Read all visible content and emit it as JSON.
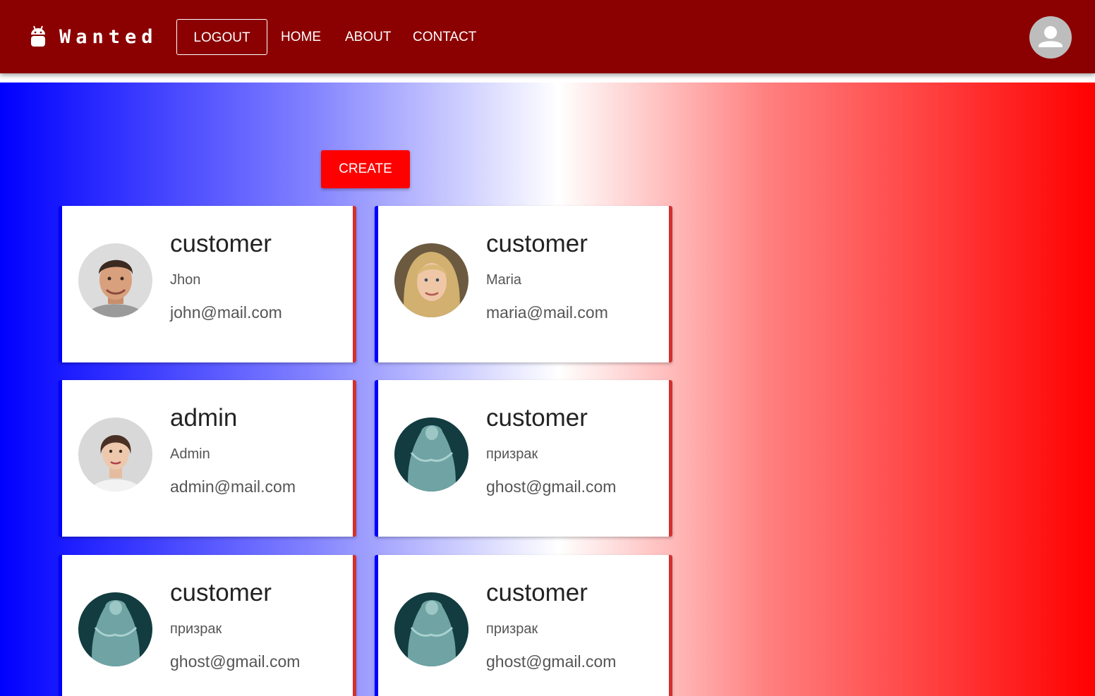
{
  "header": {
    "brand": "Wanted",
    "brand_icon": "android-icon",
    "logout_label": "LOGOUT",
    "nav": [
      {
        "label": "HOME"
      },
      {
        "label": "ABOUT"
      },
      {
        "label": "CONTACT"
      }
    ],
    "account_icon": "account-circle-icon"
  },
  "toolbar": {
    "create_label": "CREATE"
  },
  "colors": {
    "appbar": "#8b0000",
    "create_button": "#ff0000",
    "card_left_border": "#0000ff",
    "card_right_border": "#d32f2f",
    "gradient": [
      "#0000ff",
      "#ffffff",
      "#ff0000"
    ]
  },
  "users": [
    {
      "role": "customer",
      "name": "Jhon",
      "email": "john@mail.com",
      "photo": "man-portrait"
    },
    {
      "role": "customer",
      "name": "Maria",
      "email": "maria@mail.com",
      "photo": "blonde-woman-portrait"
    },
    {
      "role": "admin",
      "name": "Admin",
      "email": "admin@mail.com",
      "photo": "woman-portrait"
    },
    {
      "role": "customer",
      "name": "призрак",
      "email": "ghost@gmail.com",
      "photo": "ghost-image"
    },
    {
      "role": "customer",
      "name": "призрак",
      "email": "ghost@gmail.com",
      "photo": "ghost-image"
    },
    {
      "role": "customer",
      "name": "призрак",
      "email": "ghost@gmail.com",
      "photo": "ghost-image"
    }
  ]
}
